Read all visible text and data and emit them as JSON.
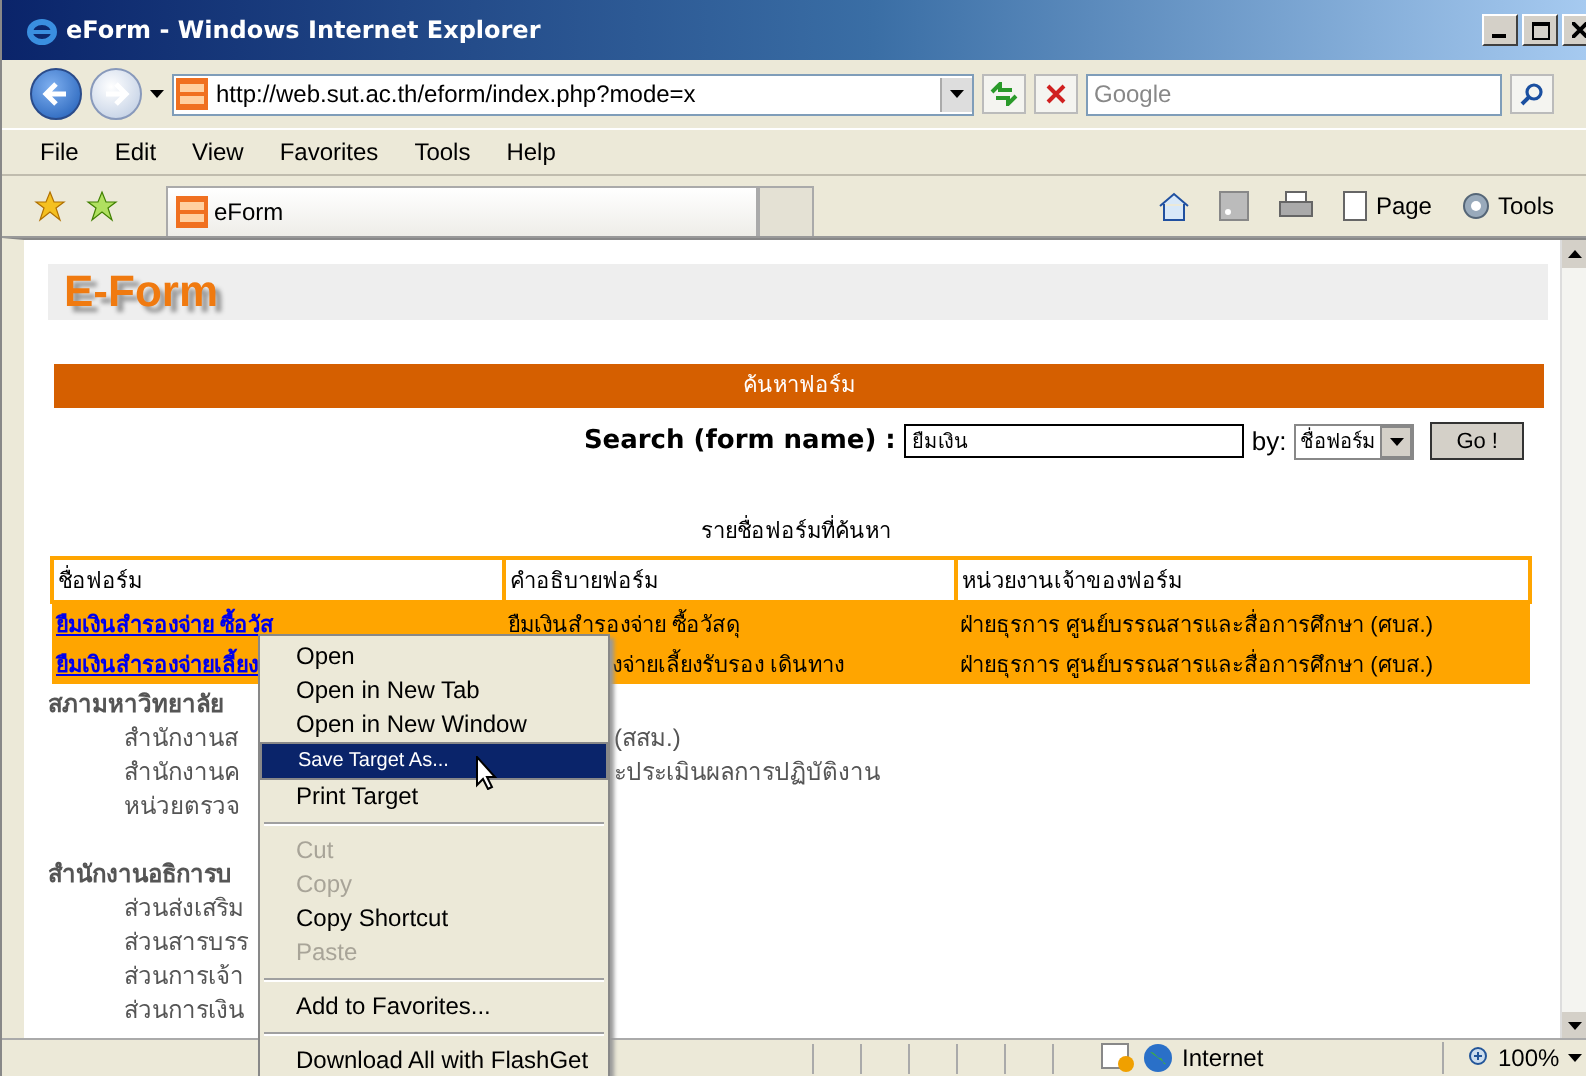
{
  "window": {
    "title": "eForm - Windows Internet Explorer"
  },
  "address_bar": {
    "url": "http://web.sut.ac.th/eform/index.php?mode=x"
  },
  "search_box": {
    "placeholder": "Google"
  },
  "menu_bar": [
    "File",
    "Edit",
    "View",
    "Favorites",
    "Tools",
    "Help"
  ],
  "tabs": [
    {
      "label": "eForm",
      "selected": true
    }
  ],
  "command_bar": [
    "Page",
    "Tools"
  ],
  "page": {
    "logo": "E-Form",
    "banner": "ค้นหาฟอร์ม",
    "search": {
      "label": "Search (form name) :",
      "value": "ยืมเงิน",
      "by_label": "by:",
      "by_value": "ชื่อฟอร์ม",
      "button": "Go !"
    },
    "results_title": "รายชื่อฟอร์มที่ค้นหา",
    "table": {
      "columns": [
        "ชื่อฟอร์ม",
        "คำอธิบายฟอร์ม",
        "หน่วยงานเจ้าของฟอร์ม"
      ],
      "rows": [
        [
          "ยืมเงินสำรองจ่าย ซื้อวัส",
          "ยืมเงินสำรองจ่าย ซื้อวัสดุ",
          "ฝ่ายธุรการ ศูนย์บรรณสารและสื่อการศึกษา (ศบส.)"
        ],
        [
          "ยืมเงินสำรองจ่ายเลี้ยง",
          "งจ่ายเลี้ยงรับรอง เดินทาง",
          "ฝ่ายธุรการ ศูนย์บรรณสารและสื่อการศึกษา (ศบส.)"
        ]
      ]
    },
    "sections": [
      {
        "heading": "สภามหาวิทยาลัย",
        "items": [
          {
            "left": "สำนักงานส",
            "right": "(สสม.)"
          },
          {
            "left": "สำนักงานค",
            "right": "ะประเมินผลการปฏิบัติงาน"
          },
          {
            "left": "หน่วยตรวจ"
          }
        ]
      },
      {
        "heading": "สำนักงานอธิการบ",
        "items": [
          {
            "left": "ส่วนส่งเสริม"
          },
          {
            "left": "ส่วนสารบรร"
          },
          {
            "left": "ส่วนการเจ้า"
          },
          {
            "left": "ส่วนการเงิน"
          }
        ]
      }
    ]
  },
  "context_menu": {
    "items": [
      {
        "kind": "item",
        "label": "Open",
        "selected": false,
        "disabled": false
      },
      {
        "kind": "item",
        "label": "Open in New Tab",
        "selected": false,
        "disabled": false
      },
      {
        "kind": "item",
        "label": "Open in New Window",
        "selected": false,
        "disabled": false
      },
      {
        "kind": "item",
        "label": "Save Target As...",
        "selected": true,
        "disabled": false
      },
      {
        "kind": "item",
        "label": "Print Target",
        "selected": false,
        "disabled": false
      },
      {
        "kind": "separator"
      },
      {
        "kind": "item",
        "label": "Cut",
        "selected": false,
        "disabled": true
      },
      {
        "kind": "item",
        "label": "Copy",
        "selected": false,
        "disabled": true
      },
      {
        "kind": "item",
        "label": "Copy Shortcut",
        "selected": false,
        "disabled": false
      },
      {
        "kind": "item",
        "label": "Paste",
        "selected": false,
        "disabled": true
      },
      {
        "kind": "separator"
      },
      {
        "kind": "item",
        "label": "Add to Favorites...",
        "selected": false,
        "disabled": false
      },
      {
        "kind": "separator"
      },
      {
        "kind": "item",
        "label": "Download All with FlashGet",
        "selected": false,
        "disabled": false
      }
    ]
  },
  "status_bar": {
    "zone": "Internet",
    "zoom": "100%"
  }
}
